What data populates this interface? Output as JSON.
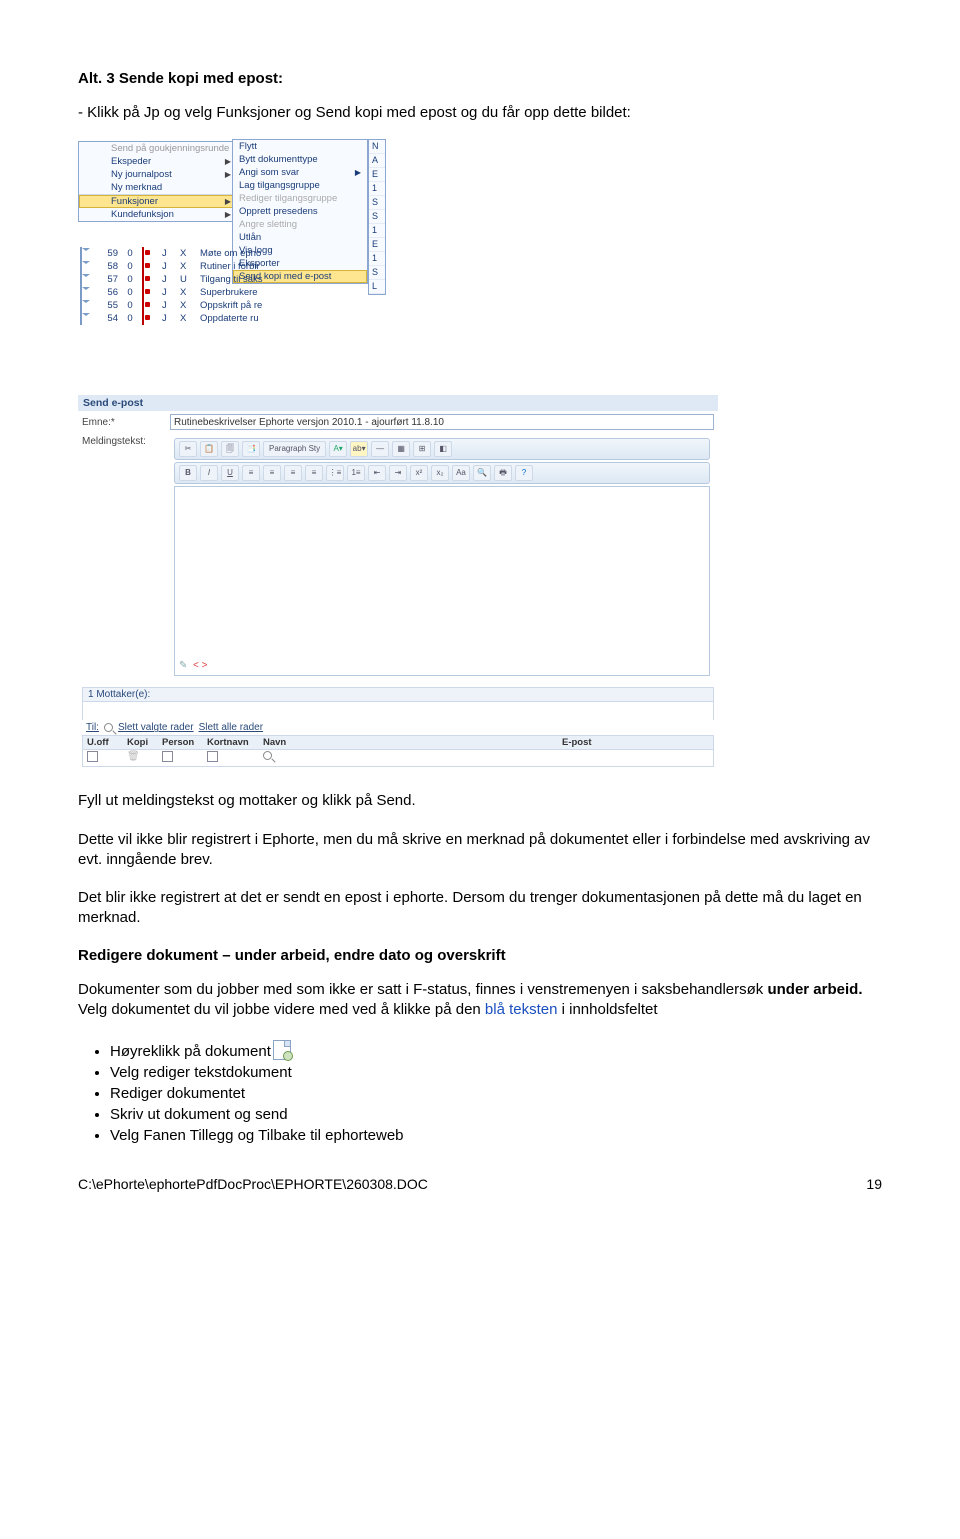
{
  "heading": "Alt. 3 Sende kopi med epost:",
  "line_intro": "- Klikk på Jp og velg Funksjoner og Send kopi med epost og du får opp dette bildet:",
  "menu1": {
    "top_items": [
      "Send på goukjenningsrunde",
      "Ekspeder",
      "Ny journalpost",
      "Ny merknad"
    ],
    "highlight": "Funksjoner",
    "below": "Kundefunksjon",
    "submenu": {
      "top": [
        "Flytt",
        "Bytt dokumenttype",
        "Angi som svar",
        "Lag tilgangsgruppe",
        "Rediger tilgangsgruppe",
        "Opprett presedens",
        "Angre sletting",
        "Utlån",
        "Vis logg",
        "Eksporter"
      ],
      "highlight": "Send kopi med e-post"
    },
    "farcol": [
      "N",
      "A",
      "E",
      "1",
      "S",
      "S",
      "1",
      "E",
      "1",
      "S",
      "L"
    ]
  },
  "grid": [
    {
      "n": "59",
      "i": "0",
      "j": "J",
      "s": "X",
      "t": "Møte om epho"
    },
    {
      "n": "58",
      "i": "0",
      "j": "J",
      "s": "X",
      "t": "Rutiner i forbir"
    },
    {
      "n": "57",
      "i": "0",
      "j": "J",
      "s": "U",
      "t": "Tilgang til saks"
    },
    {
      "n": "56",
      "i": "0",
      "j": "J",
      "s": "X",
      "t": "Superbrukere"
    },
    {
      "n": "55",
      "i": "0",
      "j": "J",
      "s": "X",
      "t": "Oppskrift på re"
    },
    {
      "n": "54",
      "i": "0",
      "j": "J",
      "s": "X",
      "t": "Oppdaterte ru"
    }
  ],
  "sendpost": {
    "title": "Send e-post",
    "emne_label": "Emne:*",
    "emne_value": "Rutinebeskrivelser Ephorte versjon 2010.1 - ajourført 11.8.10",
    "mtext_label": "Meldingstekst:",
    "toolbar_paragraph": "Paragraph Sty",
    "tb_bold": "B",
    "tb_italic": "I",
    "tb_under": "U",
    "editor_corner_1": "✎",
    "editor_corner_2": "< >",
    "mottaker_label": "1 Mottaker(e):",
    "til_label": "Til:",
    "slett1": "Slett valgte rader",
    "slett2": "Slett alle rader",
    "th": {
      "a": "U.off",
      "b": "Kopi",
      "c": "Person",
      "d": "Kortnavn",
      "e": "Navn",
      "f": "E-post"
    }
  },
  "p_fill": "Fyll ut meldingstekst og mottaker og klikk på Send.",
  "p_reg1": "Dette vil ikke blir registrert i Ephorte, men du må skrive en merknad på dokumentet eller i forbindelse med avskriving av evt. inngående brev.",
  "p_reg2": "Det blir ikke registrert at det er sendt en epost i ephorte. Dersom du trenger dokumentasjonen på dette må du laget en merknad.",
  "h_redigere": "Redigere dokument – under arbeid, endre dato og overskrift",
  "p_dok_pre": "Dokumenter som du jobber med som ikke er satt i F-status, finnes i venstremenyen i saksbehandlersøk ",
  "p_dok_bold": "under arbeid.",
  "p_dok_mid": " Velg dokumentet du vil jobbe videre med ved å klikke på den ",
  "p_dok_blue": "blå teksten",
  "p_dok_end": " i innholdsfeltet",
  "bul": [
    "Høyreklikk på dokument",
    "Velg rediger tekstdokument",
    "Rediger dokumentet",
    "Skriv ut dokument og send",
    "Velg Fanen Tillegg og Tilbake til ephorteweb"
  ],
  "footer_path": "C:\\ePhorte\\ephortePdfDocProc\\EPHORTE\\260308.DOC",
  "footer_page": "19"
}
